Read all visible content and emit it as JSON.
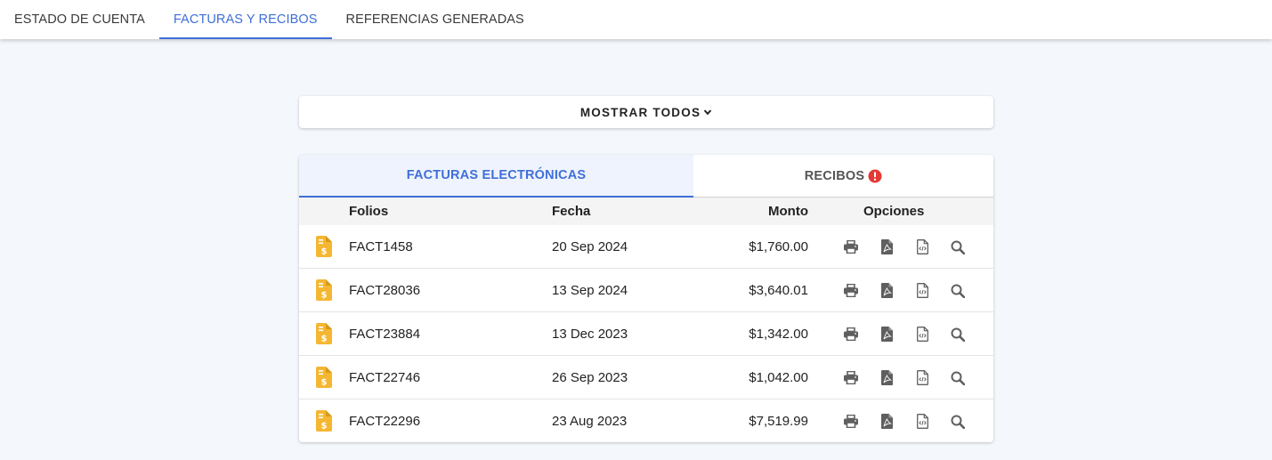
{
  "top_tabs": [
    {
      "label": "ESTADO DE CUENTA",
      "active": false
    },
    {
      "label": "FACTURAS Y RECIBOS",
      "active": true
    },
    {
      "label": "REFERENCIAS GENERADAS",
      "active": false
    }
  ],
  "show_all": {
    "label": "MOSTRAR TODOS",
    "icon": "chevron-down-icon"
  },
  "sub_tabs": {
    "facturas": "FACTURAS ELECTRÓNICAS",
    "recibos": "RECIBOS",
    "recibos_alert_icon": "alert-circle-icon"
  },
  "table": {
    "headers": {
      "folios": "Folios",
      "fecha": "Fecha",
      "monto": "Monto",
      "opciones": "Opciones"
    },
    "rows": [
      {
        "folio": "FACT1458",
        "fecha": "20 Sep 2024",
        "monto": "$1,760.00"
      },
      {
        "folio": "FACT28036",
        "fecha": "13 Sep 2024",
        "monto": "$3,640.01"
      },
      {
        "folio": "FACT23884",
        "fecha": "13 Dec 2023",
        "monto": "$1,342.00"
      },
      {
        "folio": "FACT22746",
        "fecha": "26 Sep 2023",
        "monto": "$1,042.00"
      },
      {
        "folio": "FACT22296",
        "fecha": "23 Aug 2023",
        "monto": "$7,519.99"
      }
    ],
    "row_icon": "invoice-file-icon",
    "option_icons": [
      "print-icon",
      "pdf-file-icon",
      "xml-file-icon",
      "search-icon"
    ]
  },
  "colors": {
    "accent": "#3f6fd8",
    "invoice_icon": "#f5b731",
    "alert": "#e53935",
    "option_icon": "#5f5f5f"
  }
}
